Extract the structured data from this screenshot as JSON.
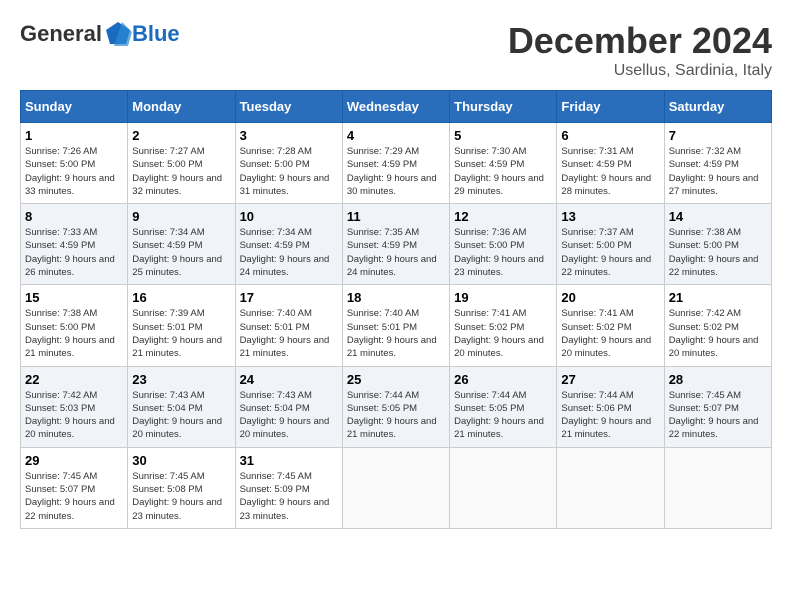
{
  "header": {
    "logo_general": "General",
    "logo_blue": "Blue",
    "month": "December 2024",
    "location": "Usellus, Sardinia, Italy"
  },
  "weekdays": [
    "Sunday",
    "Monday",
    "Tuesday",
    "Wednesday",
    "Thursday",
    "Friday",
    "Saturday"
  ],
  "weeks": [
    [
      {
        "day": "1",
        "sunrise": "Sunrise: 7:26 AM",
        "sunset": "Sunset: 5:00 PM",
        "daylight": "Daylight: 9 hours and 33 minutes."
      },
      {
        "day": "2",
        "sunrise": "Sunrise: 7:27 AM",
        "sunset": "Sunset: 5:00 PM",
        "daylight": "Daylight: 9 hours and 32 minutes."
      },
      {
        "day": "3",
        "sunrise": "Sunrise: 7:28 AM",
        "sunset": "Sunset: 5:00 PM",
        "daylight": "Daylight: 9 hours and 31 minutes."
      },
      {
        "day": "4",
        "sunrise": "Sunrise: 7:29 AM",
        "sunset": "Sunset: 4:59 PM",
        "daylight": "Daylight: 9 hours and 30 minutes."
      },
      {
        "day": "5",
        "sunrise": "Sunrise: 7:30 AM",
        "sunset": "Sunset: 4:59 PM",
        "daylight": "Daylight: 9 hours and 29 minutes."
      },
      {
        "day": "6",
        "sunrise": "Sunrise: 7:31 AM",
        "sunset": "Sunset: 4:59 PM",
        "daylight": "Daylight: 9 hours and 28 minutes."
      },
      {
        "day": "7",
        "sunrise": "Sunrise: 7:32 AM",
        "sunset": "Sunset: 4:59 PM",
        "daylight": "Daylight: 9 hours and 27 minutes."
      }
    ],
    [
      {
        "day": "8",
        "sunrise": "Sunrise: 7:33 AM",
        "sunset": "Sunset: 4:59 PM",
        "daylight": "Daylight: 9 hours and 26 minutes."
      },
      {
        "day": "9",
        "sunrise": "Sunrise: 7:34 AM",
        "sunset": "Sunset: 4:59 PM",
        "daylight": "Daylight: 9 hours and 25 minutes."
      },
      {
        "day": "10",
        "sunrise": "Sunrise: 7:34 AM",
        "sunset": "Sunset: 4:59 PM",
        "daylight": "Daylight: 9 hours and 24 minutes."
      },
      {
        "day": "11",
        "sunrise": "Sunrise: 7:35 AM",
        "sunset": "Sunset: 4:59 PM",
        "daylight": "Daylight: 9 hours and 24 minutes."
      },
      {
        "day": "12",
        "sunrise": "Sunrise: 7:36 AM",
        "sunset": "Sunset: 5:00 PM",
        "daylight": "Daylight: 9 hours and 23 minutes."
      },
      {
        "day": "13",
        "sunrise": "Sunrise: 7:37 AM",
        "sunset": "Sunset: 5:00 PM",
        "daylight": "Daylight: 9 hours and 22 minutes."
      },
      {
        "day": "14",
        "sunrise": "Sunrise: 7:38 AM",
        "sunset": "Sunset: 5:00 PM",
        "daylight": "Daylight: 9 hours and 22 minutes."
      }
    ],
    [
      {
        "day": "15",
        "sunrise": "Sunrise: 7:38 AM",
        "sunset": "Sunset: 5:00 PM",
        "daylight": "Daylight: 9 hours and 21 minutes."
      },
      {
        "day": "16",
        "sunrise": "Sunrise: 7:39 AM",
        "sunset": "Sunset: 5:01 PM",
        "daylight": "Daylight: 9 hours and 21 minutes."
      },
      {
        "day": "17",
        "sunrise": "Sunrise: 7:40 AM",
        "sunset": "Sunset: 5:01 PM",
        "daylight": "Daylight: 9 hours and 21 minutes."
      },
      {
        "day": "18",
        "sunrise": "Sunrise: 7:40 AM",
        "sunset": "Sunset: 5:01 PM",
        "daylight": "Daylight: 9 hours and 21 minutes."
      },
      {
        "day": "19",
        "sunrise": "Sunrise: 7:41 AM",
        "sunset": "Sunset: 5:02 PM",
        "daylight": "Daylight: 9 hours and 20 minutes."
      },
      {
        "day": "20",
        "sunrise": "Sunrise: 7:41 AM",
        "sunset": "Sunset: 5:02 PM",
        "daylight": "Daylight: 9 hours and 20 minutes."
      },
      {
        "day": "21",
        "sunrise": "Sunrise: 7:42 AM",
        "sunset": "Sunset: 5:02 PM",
        "daylight": "Daylight: 9 hours and 20 minutes."
      }
    ],
    [
      {
        "day": "22",
        "sunrise": "Sunrise: 7:42 AM",
        "sunset": "Sunset: 5:03 PM",
        "daylight": "Daylight: 9 hours and 20 minutes."
      },
      {
        "day": "23",
        "sunrise": "Sunrise: 7:43 AM",
        "sunset": "Sunset: 5:04 PM",
        "daylight": "Daylight: 9 hours and 20 minutes."
      },
      {
        "day": "24",
        "sunrise": "Sunrise: 7:43 AM",
        "sunset": "Sunset: 5:04 PM",
        "daylight": "Daylight: 9 hours and 20 minutes."
      },
      {
        "day": "25",
        "sunrise": "Sunrise: 7:44 AM",
        "sunset": "Sunset: 5:05 PM",
        "daylight": "Daylight: 9 hours and 21 minutes."
      },
      {
        "day": "26",
        "sunrise": "Sunrise: 7:44 AM",
        "sunset": "Sunset: 5:05 PM",
        "daylight": "Daylight: 9 hours and 21 minutes."
      },
      {
        "day": "27",
        "sunrise": "Sunrise: 7:44 AM",
        "sunset": "Sunset: 5:06 PM",
        "daylight": "Daylight: 9 hours and 21 minutes."
      },
      {
        "day": "28",
        "sunrise": "Sunrise: 7:45 AM",
        "sunset": "Sunset: 5:07 PM",
        "daylight": "Daylight: 9 hours and 22 minutes."
      }
    ],
    [
      {
        "day": "29",
        "sunrise": "Sunrise: 7:45 AM",
        "sunset": "Sunset: 5:07 PM",
        "daylight": "Daylight: 9 hours and 22 minutes."
      },
      {
        "day": "30",
        "sunrise": "Sunrise: 7:45 AM",
        "sunset": "Sunset: 5:08 PM",
        "daylight": "Daylight: 9 hours and 23 minutes."
      },
      {
        "day": "31",
        "sunrise": "Sunrise: 7:45 AM",
        "sunset": "Sunset: 5:09 PM",
        "daylight": "Daylight: 9 hours and 23 minutes."
      },
      null,
      null,
      null,
      null
    ]
  ]
}
